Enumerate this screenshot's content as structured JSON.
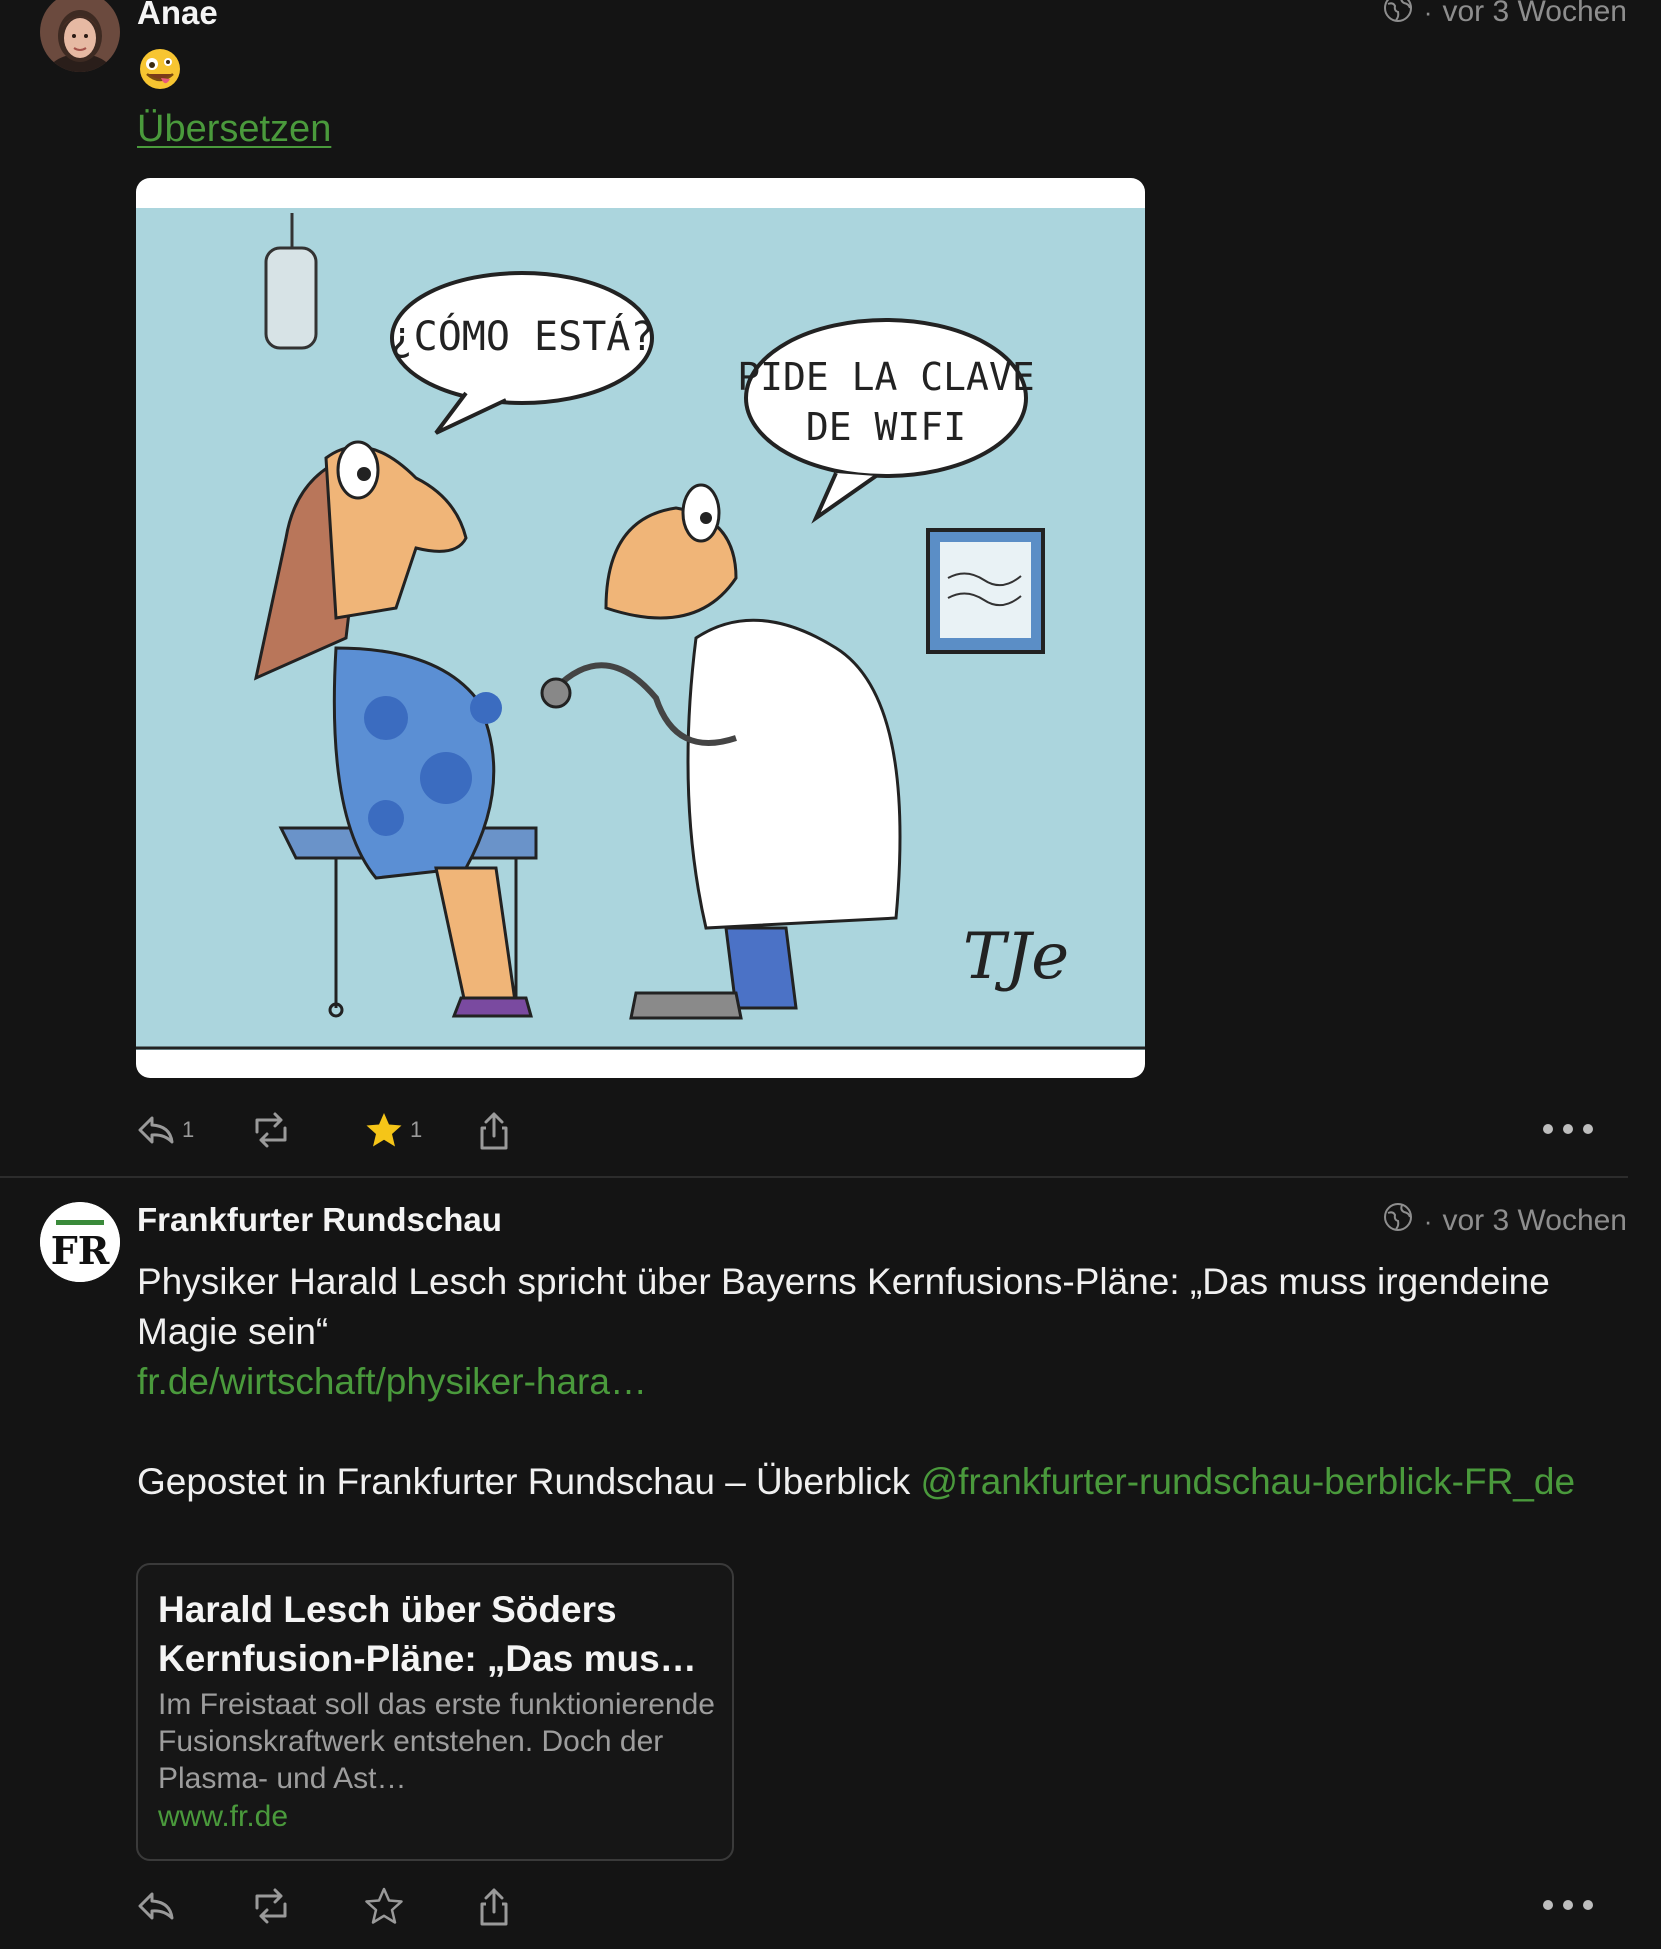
{
  "posts": [
    {
      "author": "Anae",
      "visibility_icon": "globe-icon",
      "separator": "·",
      "time": "vor 3 Wochen",
      "emoji": "zany-face-emoji",
      "translate_label": "Übersetzen",
      "image": {
        "bubble_left": "¿CÓMO ESTÁ?",
        "bubble_right_line1": "PIDE LA CLAVE",
        "bubble_right_line2": "DE WIFI",
        "signature": "TJe"
      },
      "actions": {
        "reply_count": "1",
        "boost_count": "",
        "favourite_count": "1",
        "favourited": true
      }
    },
    {
      "author": "Frankfurter Rundschau",
      "avatar_text": "FR",
      "visibility_icon": "globe-icon",
      "separator": "·",
      "time": "vor 3 Wochen",
      "text_line1": "Physiker Harald Lesch spricht über Bayerns Kernfusions-Pläne: „Das muss irgendeine Magie sein“",
      "link_text": "fr.de/wirtschaft/physiker-hara…",
      "posted_in_prefix": "Gepostet in Frankfurter Rundschau – Überblick ",
      "posted_in_handle": "@frankfurter-rundschau-berblick-FR_de",
      "card": {
        "title": "Harald Lesch über Söders Kernfusion-Pläne: „Das mus…",
        "description": "Im Freistaat soll das erste funktionierende Fusionskraftwerk entstehen. Doch der Plasma- und Ast…",
        "domain": "www.fr.de"
      },
      "actions": {
        "reply_count": "",
        "boost_count": "",
        "favourite_count": "",
        "favourited": false
      }
    }
  ],
  "colors": {
    "background": "#141414",
    "link_green": "#4a9a3c",
    "muted": "#8e8e8e",
    "star_active": "#f5c518"
  }
}
